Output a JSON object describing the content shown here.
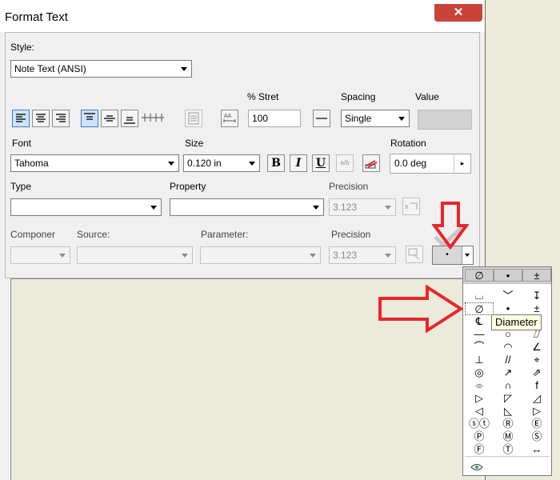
{
  "window": {
    "title": "Format Text",
    "close_glyph": "✕"
  },
  "style": {
    "label": "Style:",
    "value": "Note Text (ANSI)"
  },
  "labels": {
    "stretch": "% Stret",
    "spacing": "Spacing",
    "value": "Value",
    "font": "Font",
    "size": "Size",
    "rotation": "Rotation",
    "type": "Type",
    "property": "Property",
    "precision1": "Precision",
    "component": "Componer",
    "source": "Source:",
    "parameter": "Parameter:",
    "precision2": "Precision"
  },
  "fields": {
    "stretch": "100",
    "spacing": "Single",
    "font": "Tahoma",
    "size": "0.120 in",
    "rotation": "0.0 deg",
    "precision1": "3.123",
    "precision2": "3.123",
    "symbol_button": "•"
  },
  "format_buttons": {
    "bold": "B",
    "italic": "I",
    "underline": "U",
    "stack": "a/b"
  },
  "symbols": {
    "header": [
      "∅",
      "•",
      "±"
    ],
    "tooltip": "Diameter",
    "rows": [
      [
        "⌴",
        "﹀",
        "↧"
      ],
      [
        "∅",
        "•",
        "±"
      ],
      [
        "℄",
        "",
        ""
      ],
      [
        "—",
        "○",
        "⌰"
      ],
      [
        "⌒",
        "◠",
        "∠"
      ],
      [
        "⊥",
        "//",
        "⌖"
      ],
      [
        "◎",
        "↗",
        "⇗"
      ],
      [
        "⌯",
        "∩",
        "f"
      ],
      [
        "▷",
        "◸",
        "◿"
      ],
      [
        "◁",
        "◺",
        "▷"
      ],
      [
        "ⓢⓣ",
        "Ⓡ",
        "Ⓔ"
      ],
      [
        "Ⓟ",
        "Ⓜ",
        "Ⓢ"
      ],
      [
        "Ⓕ",
        "Ⓣ",
        "↔"
      ]
    ],
    "footer_icon": "shape-icon"
  },
  "colors": {
    "selected": "#cde3f8",
    "arrow": "#e8262d"
  }
}
